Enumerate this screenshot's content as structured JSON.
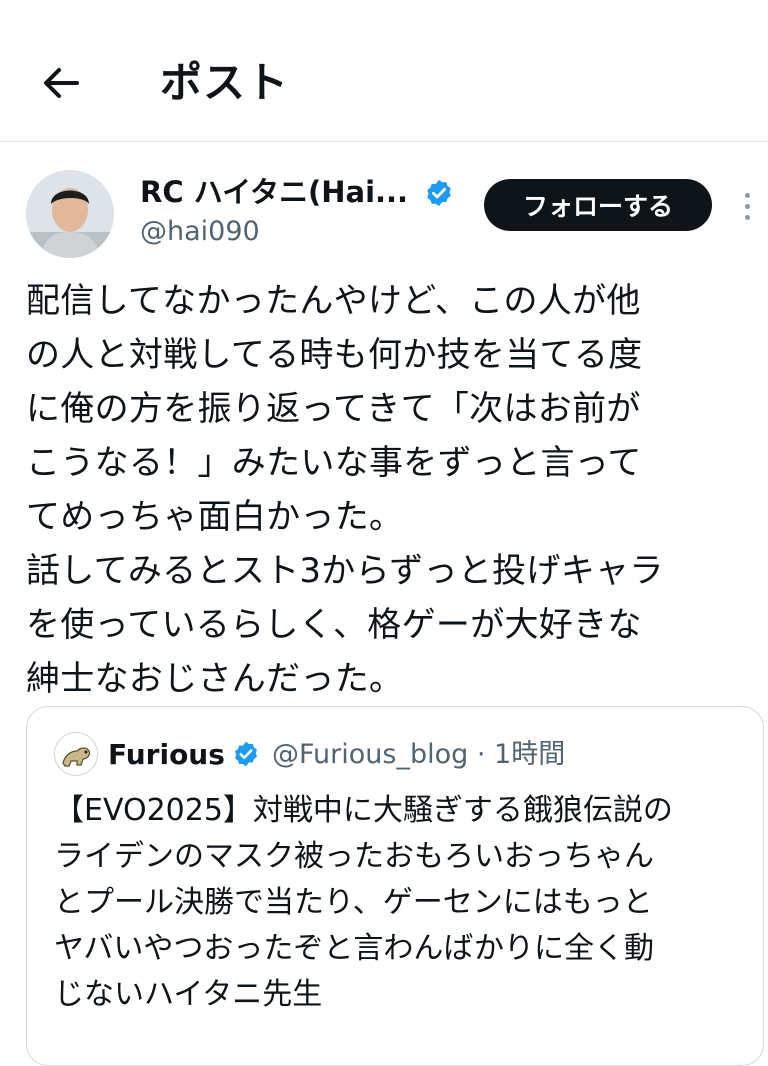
{
  "header": {
    "title": "ポスト",
    "back_icon": "arrow-left-icon"
  },
  "post": {
    "author": {
      "name": "RC ハイタニ(Hai...",
      "handle": "@hai090",
      "verified": true
    },
    "follow_label": "フォローする",
    "more_icon": "more-vertical-icon",
    "text": "配信してなかったんやけど、この人が他\nの人と対戦してる時も何か技を当てる度\nに俺の方を振り返ってきて「次はお前が\nこうなる！」みたいな事をずっと言って\nてめっちゃ面白かった。\n話してみるとスト3からずっと投げキャラ\nを使っているらしく、格ゲーが大好きな\n紳士なおじさんだった。"
  },
  "quote": {
    "name": "Furious",
    "verified": true,
    "handle": "@Furious_blog",
    "time": "1時間",
    "meta": "@Furious_blog · 1時間",
    "text": "【EVO2025】対戦中に大騒ぎする餓狼伝説の\nライデンのマスク被ったおもろいおっちゃん\nとプール決勝で当たり、ゲーセンにはもっと\nヤバいやつおったぞと言わんばかりに全く動\nじないハイタニ先生"
  },
  "colors": {
    "verified": "#1d9bf0",
    "follow_bg": "#0f1419",
    "secondary_text": "#536471"
  }
}
